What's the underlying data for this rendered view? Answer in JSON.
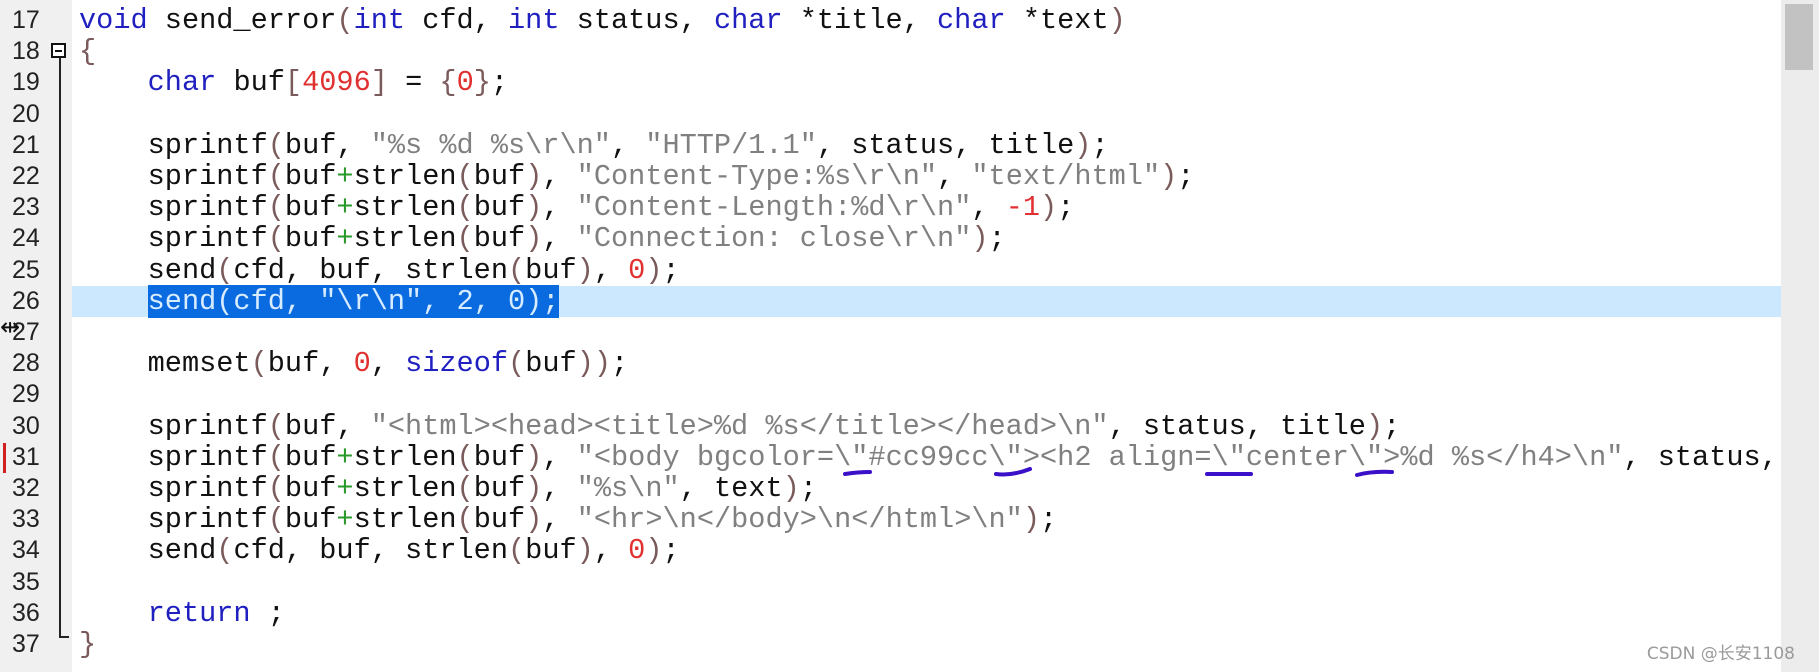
{
  "editor": {
    "first_line": 17,
    "highlighted_line": 26,
    "lines": [
      {
        "num": "17",
        "tokens": [
          [
            "void",
            "k"
          ],
          [
            " send_error",
            "t"
          ],
          [
            "(",
            "p"
          ],
          [
            "int",
            "k"
          ],
          [
            " cfd, ",
            "t"
          ],
          [
            "int",
            "k"
          ],
          [
            " status, ",
            "t"
          ],
          [
            "char",
            "k"
          ],
          [
            " *title, ",
            "t"
          ],
          [
            "char",
            "k"
          ],
          [
            " *text",
            "t"
          ],
          [
            ")",
            "p"
          ]
        ]
      },
      {
        "num": "18",
        "tokens": [
          [
            "{",
            "p"
          ]
        ]
      },
      {
        "num": "19",
        "tokens": [
          [
            "    ",
            "t"
          ],
          [
            "char",
            "k"
          ],
          [
            " buf",
            "t"
          ],
          [
            "[",
            "p"
          ],
          [
            "4096",
            "n"
          ],
          [
            "]",
            "p"
          ],
          [
            " = ",
            "t"
          ],
          [
            "{",
            "p"
          ],
          [
            "0",
            "n"
          ],
          [
            "}",
            "p"
          ],
          [
            ";",
            "t"
          ]
        ]
      },
      {
        "num": "20",
        "tokens": []
      },
      {
        "num": "21",
        "tokens": [
          [
            "    sprintf",
            "t"
          ],
          [
            "(",
            "p"
          ],
          [
            "buf, ",
            "t"
          ],
          [
            "\"%s %d %s\\r\\n\"",
            "s"
          ],
          [
            ", ",
            "t"
          ],
          [
            "\"HTTP/1.1\"",
            "s"
          ],
          [
            ", status, title",
            "t"
          ],
          [
            ")",
            "p"
          ],
          [
            ";",
            "t"
          ]
        ]
      },
      {
        "num": "22",
        "tokens": [
          [
            "    sprintf",
            "t"
          ],
          [
            "(",
            "p"
          ],
          [
            "buf",
            "t"
          ],
          [
            "+",
            "o"
          ],
          [
            "strlen",
            "t"
          ],
          [
            "(",
            "p"
          ],
          [
            "buf",
            "t"
          ],
          [
            ")",
            "p"
          ],
          [
            ", ",
            "t"
          ],
          [
            "\"Content-Type:%s\\r\\n\"",
            "s"
          ],
          [
            ", ",
            "t"
          ],
          [
            "\"text/html\"",
            "s"
          ],
          [
            ")",
            "p"
          ],
          [
            ";",
            "t"
          ]
        ]
      },
      {
        "num": "23",
        "tokens": [
          [
            "    sprintf",
            "t"
          ],
          [
            "(",
            "p"
          ],
          [
            "buf",
            "t"
          ],
          [
            "+",
            "o"
          ],
          [
            "strlen",
            "t"
          ],
          [
            "(",
            "p"
          ],
          [
            "buf",
            "t"
          ],
          [
            ")",
            "p"
          ],
          [
            ", ",
            "t"
          ],
          [
            "\"Content-Length:%d\\r\\n\"",
            "s"
          ],
          [
            ", ",
            "t"
          ],
          [
            "-1",
            "n"
          ],
          [
            ")",
            "p"
          ],
          [
            ";",
            "t"
          ]
        ]
      },
      {
        "num": "24",
        "tokens": [
          [
            "    sprintf",
            "t"
          ],
          [
            "(",
            "p"
          ],
          [
            "buf",
            "t"
          ],
          [
            "+",
            "o"
          ],
          [
            "strlen",
            "t"
          ],
          [
            "(",
            "p"
          ],
          [
            "buf",
            "t"
          ],
          [
            ")",
            "p"
          ],
          [
            ", ",
            "t"
          ],
          [
            "\"Connection: close\\r\\n\"",
            "s"
          ],
          [
            ")",
            "p"
          ],
          [
            ";",
            "t"
          ]
        ]
      },
      {
        "num": "25",
        "tokens": [
          [
            "    send",
            "t"
          ],
          [
            "(",
            "p"
          ],
          [
            "cfd, buf, strlen",
            "t"
          ],
          [
            "(",
            "p"
          ],
          [
            "buf",
            "t"
          ],
          [
            ")",
            "p"
          ],
          [
            ", ",
            "t"
          ],
          [
            "0",
            "n"
          ],
          [
            ")",
            "p"
          ],
          [
            ";",
            "t"
          ]
        ]
      },
      {
        "num": "26",
        "selected": "send(cfd, \"\\r\\n\", 2, 0);",
        "tokens": [
          [
            "    ",
            "t"
          ]
        ]
      },
      {
        "num": "27",
        "tokens": []
      },
      {
        "num": "28",
        "tokens": [
          [
            "    memset",
            "t"
          ],
          [
            "(",
            "p"
          ],
          [
            "buf, ",
            "t"
          ],
          [
            "0",
            "n"
          ],
          [
            ", ",
            "t"
          ],
          [
            "sizeof",
            "k"
          ],
          [
            "(",
            "p"
          ],
          [
            "buf",
            "t"
          ],
          [
            "))",
            "p"
          ],
          [
            ";",
            "t"
          ]
        ]
      },
      {
        "num": "29",
        "tokens": []
      },
      {
        "num": "30",
        "tokens": [
          [
            "    sprintf",
            "t"
          ],
          [
            "(",
            "p"
          ],
          [
            "buf, ",
            "t"
          ],
          [
            "\"<html><head><title>%d %s</title></head>\\n\"",
            "s"
          ],
          [
            ", status, title",
            "t"
          ],
          [
            ")",
            "p"
          ],
          [
            ";",
            "t"
          ]
        ]
      },
      {
        "num": "31",
        "tokens": [
          [
            "    sprintf",
            "t"
          ],
          [
            "(",
            "p"
          ],
          [
            "buf",
            "t"
          ],
          [
            "+",
            "o"
          ],
          [
            "strlen",
            "t"
          ],
          [
            "(",
            "p"
          ],
          [
            "buf",
            "t"
          ],
          [
            ")",
            "p"
          ],
          [
            ", ",
            "t"
          ],
          [
            "\"<body bgcolor=\\\"#cc99cc\\\"><h2 align=\\\"center\\\">%d %s</h4>\\n\"",
            "s"
          ],
          [
            ", status,",
            "t"
          ]
        ]
      },
      {
        "num": "32",
        "tokens": [
          [
            "    sprintf",
            "t"
          ],
          [
            "(",
            "p"
          ],
          [
            "buf",
            "t"
          ],
          [
            "+",
            "o"
          ],
          [
            "strlen",
            "t"
          ],
          [
            "(",
            "p"
          ],
          [
            "buf",
            "t"
          ],
          [
            ")",
            "p"
          ],
          [
            ", ",
            "t"
          ],
          [
            "\"%s\\n\"",
            "s"
          ],
          [
            ", text",
            "t"
          ],
          [
            ")",
            "p"
          ],
          [
            ";",
            "t"
          ]
        ]
      },
      {
        "num": "33",
        "tokens": [
          [
            "    sprintf",
            "t"
          ],
          [
            "(",
            "p"
          ],
          [
            "buf",
            "t"
          ],
          [
            "+",
            "o"
          ],
          [
            "strlen",
            "t"
          ],
          [
            "(",
            "p"
          ],
          [
            "buf",
            "t"
          ],
          [
            ")",
            "p"
          ],
          [
            ", ",
            "t"
          ],
          [
            "\"<hr>\\n</body>\\n</html>\\n\"",
            "s"
          ],
          [
            ")",
            "p"
          ],
          [
            ";",
            "t"
          ]
        ]
      },
      {
        "num": "34",
        "tokens": [
          [
            "    send",
            "t"
          ],
          [
            "(",
            "p"
          ],
          [
            "cfd, buf, strlen",
            "t"
          ],
          [
            "(",
            "p"
          ],
          [
            "buf",
            "t"
          ],
          [
            ")",
            "p"
          ],
          [
            ", ",
            "t"
          ],
          [
            "0",
            "n"
          ],
          [
            ")",
            "p"
          ],
          [
            ";",
            "t"
          ]
        ]
      },
      {
        "num": "35",
        "tokens": []
      },
      {
        "num": "36",
        "tokens": [
          [
            "    ",
            "t"
          ],
          [
            "return",
            "k"
          ],
          [
            " ;",
            "t"
          ]
        ]
      },
      {
        "num": "37",
        "tokens": [
          [
            "}",
            "p"
          ]
        ]
      }
    ]
  },
  "colors": {
    "keyword": "#2020c0",
    "string": "#808080",
    "number": "#e03030",
    "operator": "#2a9a2a",
    "line_highlight": "#cce8ff",
    "selection": "#0a6be0",
    "annotation": "#3a10c8"
  },
  "icons": {
    "fold": "fold-minus-icon",
    "cursor": "resize-cursor-icon"
  },
  "watermark": "CSDN @长安1108"
}
